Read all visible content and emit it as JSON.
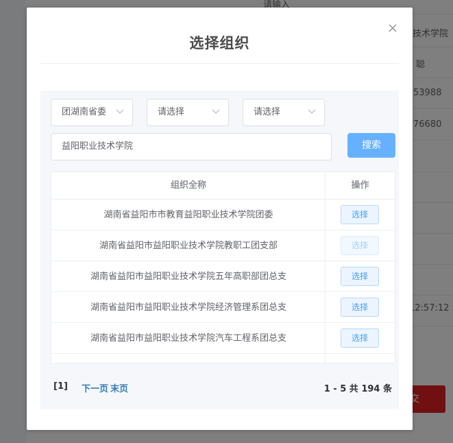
{
  "background": {
    "fragments": [
      "请输入",
      "技术学院",
      "聪",
      "53988",
      "76680",
      "12:57:12",
      "交"
    ]
  },
  "dialog": {
    "title": "选择组织",
    "close_icon": "close-icon",
    "filters": {
      "province": "团湖南省委",
      "city_placeholder": "请选择",
      "county_placeholder": "请选择"
    },
    "search": {
      "value": "益阳职业技术学院",
      "button_label": "搜索"
    },
    "table": {
      "headers": [
        "组织全称",
        "操作"
      ],
      "rows": [
        {
          "name": "湖南省益阳市市教育益阳职业技术学院团委",
          "action": "选择",
          "disabled": false
        },
        {
          "name": "湖南省益阳市益阳职业技术学院教职工团支部",
          "action": "选择",
          "disabled": true
        },
        {
          "name": "湖南省益阳市益阳职业技术学院五年高职部团总支",
          "action": "选择",
          "disabled": false
        },
        {
          "name": "湖南省益阳市益阳职业技术学院经济管理系团总支",
          "action": "选择",
          "disabled": false
        },
        {
          "name": "湖南省益阳市益阳职业技术学院汽车工程系团总支",
          "action": "选择",
          "disabled": false
        }
      ]
    },
    "pagination": {
      "current": "[1]",
      "next": "下一页",
      "last": "末页",
      "summary": "1 - 5  共 194 条"
    }
  },
  "colors": {
    "primary": "#409eff",
    "search_button": "#66b1ff",
    "pager_link": "#337ab7",
    "submit_bg": "#e02020"
  }
}
